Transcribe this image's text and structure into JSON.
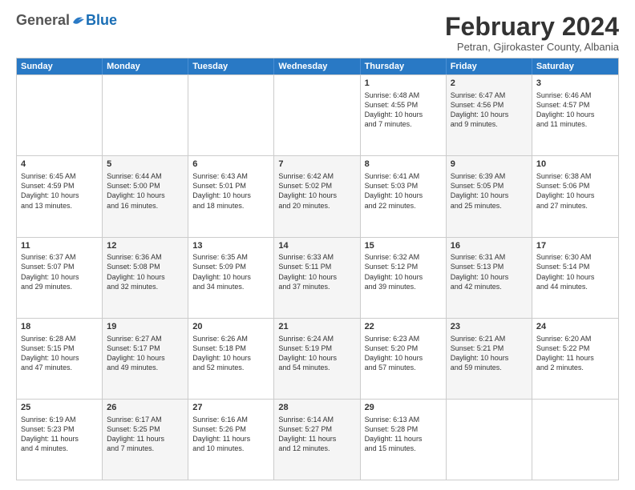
{
  "logo": {
    "general": "General",
    "blue": "Blue"
  },
  "title": "February 2024",
  "subtitle": "Petran, Gjirokaster County, Albania",
  "days": [
    "Sunday",
    "Monday",
    "Tuesday",
    "Wednesday",
    "Thursday",
    "Friday",
    "Saturday"
  ],
  "weeks": [
    [
      {
        "num": "",
        "info": "",
        "shaded": false,
        "empty": true
      },
      {
        "num": "",
        "info": "",
        "shaded": false,
        "empty": true
      },
      {
        "num": "",
        "info": "",
        "shaded": false,
        "empty": true
      },
      {
        "num": "",
        "info": "",
        "shaded": false,
        "empty": true
      },
      {
        "num": "1",
        "info": "Sunrise: 6:48 AM\nSunset: 4:55 PM\nDaylight: 10 hours\nand 7 minutes.",
        "shaded": false
      },
      {
        "num": "2",
        "info": "Sunrise: 6:47 AM\nSunset: 4:56 PM\nDaylight: 10 hours\nand 9 minutes.",
        "shaded": true
      },
      {
        "num": "3",
        "info": "Sunrise: 6:46 AM\nSunset: 4:57 PM\nDaylight: 10 hours\nand 11 minutes.",
        "shaded": false
      }
    ],
    [
      {
        "num": "4",
        "info": "Sunrise: 6:45 AM\nSunset: 4:59 PM\nDaylight: 10 hours\nand 13 minutes.",
        "shaded": false
      },
      {
        "num": "5",
        "info": "Sunrise: 6:44 AM\nSunset: 5:00 PM\nDaylight: 10 hours\nand 16 minutes.",
        "shaded": true
      },
      {
        "num": "6",
        "info": "Sunrise: 6:43 AM\nSunset: 5:01 PM\nDaylight: 10 hours\nand 18 minutes.",
        "shaded": false
      },
      {
        "num": "7",
        "info": "Sunrise: 6:42 AM\nSunset: 5:02 PM\nDaylight: 10 hours\nand 20 minutes.",
        "shaded": true
      },
      {
        "num": "8",
        "info": "Sunrise: 6:41 AM\nSunset: 5:03 PM\nDaylight: 10 hours\nand 22 minutes.",
        "shaded": false
      },
      {
        "num": "9",
        "info": "Sunrise: 6:39 AM\nSunset: 5:05 PM\nDaylight: 10 hours\nand 25 minutes.",
        "shaded": true
      },
      {
        "num": "10",
        "info": "Sunrise: 6:38 AM\nSunset: 5:06 PM\nDaylight: 10 hours\nand 27 minutes.",
        "shaded": false
      }
    ],
    [
      {
        "num": "11",
        "info": "Sunrise: 6:37 AM\nSunset: 5:07 PM\nDaylight: 10 hours\nand 29 minutes.",
        "shaded": false
      },
      {
        "num": "12",
        "info": "Sunrise: 6:36 AM\nSunset: 5:08 PM\nDaylight: 10 hours\nand 32 minutes.",
        "shaded": true
      },
      {
        "num": "13",
        "info": "Sunrise: 6:35 AM\nSunset: 5:09 PM\nDaylight: 10 hours\nand 34 minutes.",
        "shaded": false
      },
      {
        "num": "14",
        "info": "Sunrise: 6:33 AM\nSunset: 5:11 PM\nDaylight: 10 hours\nand 37 minutes.",
        "shaded": true
      },
      {
        "num": "15",
        "info": "Sunrise: 6:32 AM\nSunset: 5:12 PM\nDaylight: 10 hours\nand 39 minutes.",
        "shaded": false
      },
      {
        "num": "16",
        "info": "Sunrise: 6:31 AM\nSunset: 5:13 PM\nDaylight: 10 hours\nand 42 minutes.",
        "shaded": true
      },
      {
        "num": "17",
        "info": "Sunrise: 6:30 AM\nSunset: 5:14 PM\nDaylight: 10 hours\nand 44 minutes.",
        "shaded": false
      }
    ],
    [
      {
        "num": "18",
        "info": "Sunrise: 6:28 AM\nSunset: 5:15 PM\nDaylight: 10 hours\nand 47 minutes.",
        "shaded": false
      },
      {
        "num": "19",
        "info": "Sunrise: 6:27 AM\nSunset: 5:17 PM\nDaylight: 10 hours\nand 49 minutes.",
        "shaded": true
      },
      {
        "num": "20",
        "info": "Sunrise: 6:26 AM\nSunset: 5:18 PM\nDaylight: 10 hours\nand 52 minutes.",
        "shaded": false
      },
      {
        "num": "21",
        "info": "Sunrise: 6:24 AM\nSunset: 5:19 PM\nDaylight: 10 hours\nand 54 minutes.",
        "shaded": true
      },
      {
        "num": "22",
        "info": "Sunrise: 6:23 AM\nSunset: 5:20 PM\nDaylight: 10 hours\nand 57 minutes.",
        "shaded": false
      },
      {
        "num": "23",
        "info": "Sunrise: 6:21 AM\nSunset: 5:21 PM\nDaylight: 10 hours\nand 59 minutes.",
        "shaded": true
      },
      {
        "num": "24",
        "info": "Sunrise: 6:20 AM\nSunset: 5:22 PM\nDaylight: 11 hours\nand 2 minutes.",
        "shaded": false
      }
    ],
    [
      {
        "num": "25",
        "info": "Sunrise: 6:19 AM\nSunset: 5:23 PM\nDaylight: 11 hours\nand 4 minutes.",
        "shaded": false
      },
      {
        "num": "26",
        "info": "Sunrise: 6:17 AM\nSunset: 5:25 PM\nDaylight: 11 hours\nand 7 minutes.",
        "shaded": true
      },
      {
        "num": "27",
        "info": "Sunrise: 6:16 AM\nSunset: 5:26 PM\nDaylight: 11 hours\nand 10 minutes.",
        "shaded": false
      },
      {
        "num": "28",
        "info": "Sunrise: 6:14 AM\nSunset: 5:27 PM\nDaylight: 11 hours\nand 12 minutes.",
        "shaded": true
      },
      {
        "num": "29",
        "info": "Sunrise: 6:13 AM\nSunset: 5:28 PM\nDaylight: 11 hours\nand 15 minutes.",
        "shaded": false
      },
      {
        "num": "",
        "info": "",
        "shaded": false,
        "empty": true
      },
      {
        "num": "",
        "info": "",
        "shaded": false,
        "empty": true
      }
    ]
  ]
}
